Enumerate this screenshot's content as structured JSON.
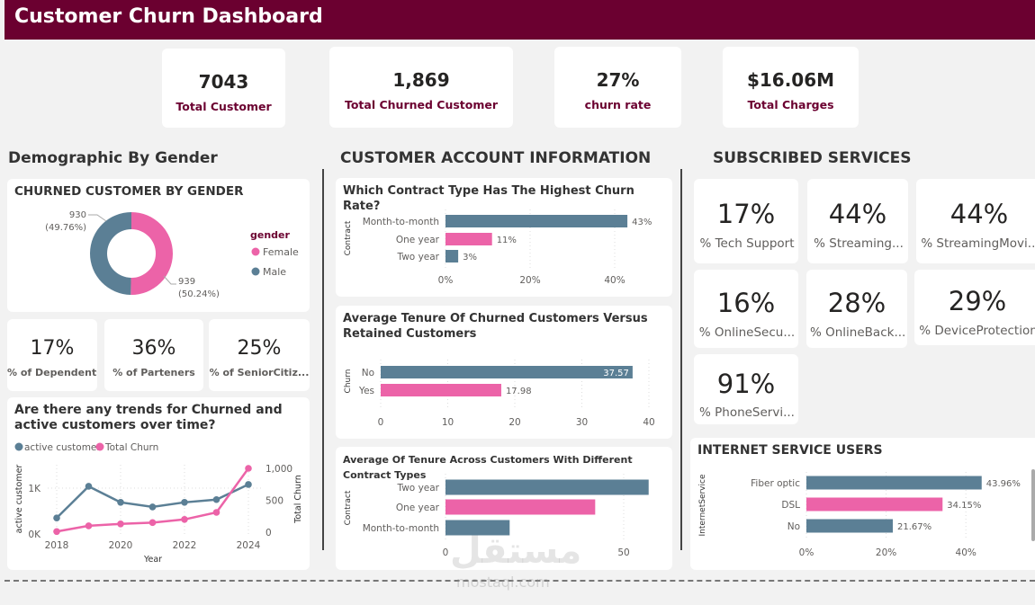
{
  "header": {
    "title": "Customer Churn Dashboard"
  },
  "colors": {
    "header": "#6b0030",
    "primary": "#5b7f95",
    "accent": "#ec63a8"
  },
  "kpis": [
    {
      "value": "7043",
      "label": "Total Customer"
    },
    {
      "value": "1,869",
      "label": "Total Churned Customer"
    },
    {
      "value": "27%",
      "label": "churn rate"
    },
    {
      "value": "$16.06M",
      "label": "Total Charges"
    }
  ],
  "sections": {
    "demographic": "Demographic By Gender",
    "account": "CUSTOMER ACCOUNT INFORMATION",
    "services": "SUBSCRIBED SERVICES"
  },
  "gender_chart": {
    "title": "CHURNED CUSTOMER BY GENDER",
    "legend_title": "gender",
    "slices": [
      {
        "name": "Female",
        "value": 939,
        "pct": "50.24%",
        "label1": "939",
        "label2": "(50.24%)"
      },
      {
        "name": "Male",
        "value": 930,
        "pct": "49.76%",
        "label1": "930",
        "label2": "(49.76%)"
      }
    ]
  },
  "demo_kpis": [
    {
      "value": "17%",
      "label": "% of Dependents"
    },
    {
      "value": "36%",
      "label": "% of Parteners"
    },
    {
      "value": "25%",
      "label": "% of SeniorCitiz..."
    }
  ],
  "chart_data": [
    {
      "type": "line",
      "title": "Are there any trends for Churned and active customers over time?",
      "xlabel": "Year",
      "ylabel": "active customer",
      "y2label": "Total Churn",
      "x": [
        2018,
        2019,
        2020,
        2021,
        2022,
        2023,
        2024
      ],
      "xticks": [
        "2018",
        "2020",
        "2022",
        "2024"
      ],
      "yticks": [
        "0K",
        "1K"
      ],
      "y2ticks": [
        "0",
        "500",
        "1,000"
      ],
      "series": [
        {
          "name": "active customer",
          "axis": "left",
          "values": [
            350,
            1040,
            690,
            590,
            690,
            750,
            1080
          ]
        },
        {
          "name": "Total Churn",
          "axis": "right",
          "values": [
            10,
            100,
            130,
            150,
            200,
            310,
            1000
          ]
        }
      ],
      "legend": "top-left"
    },
    {
      "type": "bar",
      "orientation": "horizontal",
      "title": "Which Contract Type Has The Highest Churn Rate?",
      "ylabel": "Contract",
      "categories": [
        "Month-to-month",
        "One year",
        "Two year"
      ],
      "values": [
        43,
        11,
        3
      ],
      "data_labels": [
        "43%",
        "11%",
        "3%"
      ],
      "xticks": [
        "0%",
        "20%",
        "40%"
      ],
      "xlim": [
        0,
        45
      ]
    },
    {
      "type": "bar",
      "orientation": "horizontal",
      "title": "Average Tenure Of Churned Customers Versus Retained Customers",
      "ylabel": "Churn",
      "categories": [
        "No",
        "Yes"
      ],
      "values": [
        37.57,
        17.98
      ],
      "data_labels": [
        "37.57",
        "17.98"
      ],
      "xticks": [
        "0",
        "10",
        "20",
        "30",
        "40"
      ],
      "xlim": [
        0,
        40
      ]
    },
    {
      "type": "bar",
      "orientation": "horizontal",
      "title": "Average Of Tenure Across Customers With Different Contract Types",
      "ylabel": "Contract",
      "categories": [
        "Two year",
        "One year",
        "Month-to-month"
      ],
      "values": [
        57,
        42,
        18
      ],
      "xticks": [
        "0",
        "50"
      ],
      "xlim": [
        0,
        60
      ]
    },
    {
      "type": "bar",
      "orientation": "horizontal",
      "title": "INTERNET SERVICE USERS",
      "ylabel": "InternetService",
      "categories": [
        "Fiber optic",
        "DSL",
        "No"
      ],
      "values": [
        43.96,
        34.15,
        21.67
      ],
      "data_labels": [
        "43.96%",
        "34.15%",
        "21.67%"
      ],
      "xticks": [
        "0%",
        "20%",
        "40%"
      ],
      "xlim": [
        0,
        45
      ]
    }
  ],
  "services": [
    {
      "value": "17%",
      "label": "% Tech Support"
    },
    {
      "value": "44%",
      "label": "% Streaming..."
    },
    {
      "value": "44%",
      "label": "% StreamingMovi..."
    },
    {
      "value": "16%",
      "label": "% OnlineSecu..."
    },
    {
      "value": "28%",
      "label": "% OnlineBack..."
    },
    {
      "value": "29%",
      "label": "% DeviceProtection"
    },
    {
      "value": "91%",
      "label": "% PhoneServi..."
    }
  ],
  "watermark": {
    "text": "مستقل",
    "url": "mostaql.com"
  }
}
